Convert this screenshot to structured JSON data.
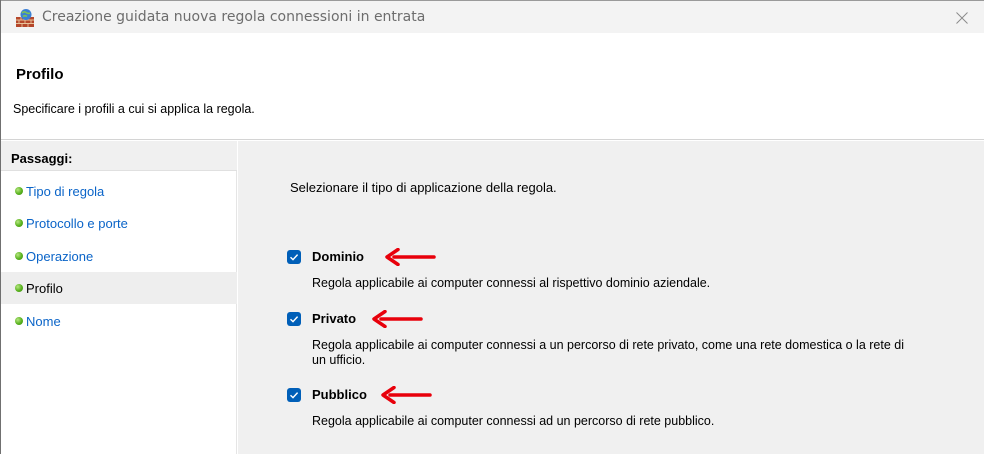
{
  "window": {
    "title": "Creazione guidata nuova regola connessioni in entrata"
  },
  "header": {
    "title": "Profilo",
    "subtitle": "Specificare i profili a cui si applica la regola."
  },
  "sidebar": {
    "heading": "Passaggi:",
    "steps": [
      {
        "label": "Tipo di regola",
        "current": false
      },
      {
        "label": "Protocollo e porte",
        "current": false
      },
      {
        "label": "Operazione",
        "current": false
      },
      {
        "label": "Profilo",
        "current": true
      },
      {
        "label": "Nome",
        "current": false
      }
    ]
  },
  "main": {
    "instructions": "Selezionare il tipo di applicazione della regola.",
    "options": [
      {
        "label": "Dominio",
        "checked": true,
        "description": "Regola applicabile ai computer connessi al rispettivo dominio aziendale."
      },
      {
        "label": "Privato",
        "checked": true,
        "description": "Regola applicabile ai computer connessi a un percorso di rete privato, come una rete domestica o la rete di un ufficio."
      },
      {
        "label": "Pubblico",
        "checked": true,
        "description": "Regola applicabile ai computer connessi ad un percorso di rete pubblico."
      }
    ]
  },
  "icons": {
    "app": "firewall-icon",
    "close": "close-icon",
    "checkbox": "checkmark-icon",
    "annotation": "red-arrow-icon",
    "step_bullet": "green-dot-icon"
  },
  "colors": {
    "link": "#0a64c8",
    "checkbox": "#005fb8",
    "annotation_arrow": "#e8000b",
    "panel_bg": "#f0f0f0"
  }
}
